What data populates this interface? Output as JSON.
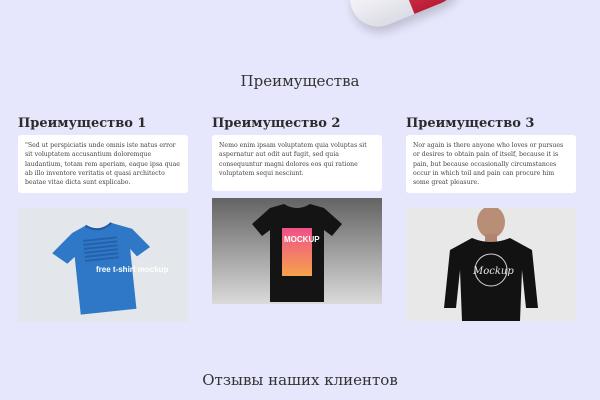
{
  "colors": {
    "background": "#e6e6fc",
    "card": "#ffffff",
    "heading": "#2b2b2b"
  },
  "advantages": {
    "section_title": "Преимущества",
    "items": [
      {
        "title": "Преимущество 1",
        "text": "\"Sed ut perspiciatis unde omnis iste natus error sit voluptatem accusantium doloremque laudantium, totam rem aperiam, eaque ipsa quae ab illo inventore veritatis et quasi architecto beatae vitae dicta sunt explicabo.",
        "image_alt": "blue t-shirt mockup",
        "image_text": "free t-shirt mockup"
      },
      {
        "title": "Преимущество 2",
        "text": "Nemo enim ipsam voluptatem quia voluptas sit aspernatur aut odit aut fugit, sed quia consequuntur magni dolores eos qui ratione voluptatem sequi nesciunt.",
        "image_alt": "black t-shirt with gradient print",
        "image_text": "MOCKUP"
      },
      {
        "title": "Преимущество 3",
        "text": "Nor again is there anyone who loves or pursues or desires to obtain pain of itself, because it is pain, but because occasionally circumstances occur in which toil and pain can procure him some great pleasure.",
        "image_alt": "man in black t-shirt",
        "image_text": "Mockup"
      }
    ]
  },
  "reviews": {
    "section_title": "Отзывы наших клиентов"
  }
}
